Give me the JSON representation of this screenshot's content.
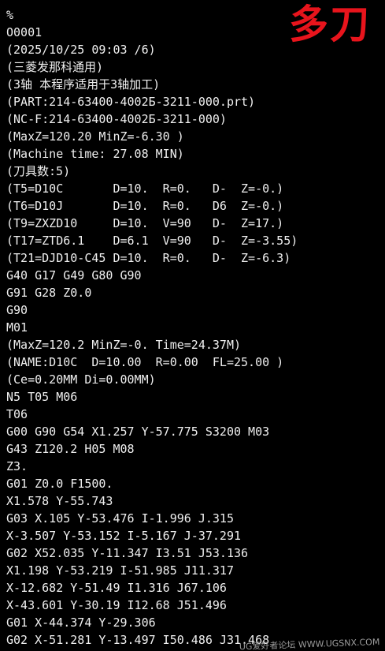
{
  "stamp_text": "多刀",
  "stamp_color": "#e8141c",
  "lines": [
    "%",
    "O0001",
    "(2025/10/25 09:03 /6)",
    "(三菱发那科通用)",
    "(3轴 本程序适用于3轴加工)",
    "(PART:214-63400-4002Б-3211-000.prt)",
    "(NC-F:214-63400-4002Б-3211-000)",
    "(MaxZ=120.20 MinZ=-6.30 )",
    "(Machine time: 27.08 MIN)",
    "(刀具数:5)",
    "(T5=D10C       D=10.  R=0.   D-  Z=-0.)",
    "(T6=D10J       D=10.  R=0.   D6  Z=-0.)",
    "(T9=ZXZD10     D=10.  V=90   D-  Z=17.)",
    "(T17=ZTD6.1    D=6.1  V=90   D-  Z=-3.55)",
    "(T21=DJD10-C45 D=10.  R=0.   D-  Z=-6.3)",
    "G40 G17 G49 G80 G90",
    "G91 G28 Z0.0",
    "G90",
    "M01",
    "(MaxZ=120.2 MinZ=-0. Time=24.37M)",
    "(NAME:D10C  D=10.00  R=0.00  FL=25.00 )",
    "(Ce=0.20MM Di=0.00MM)",
    "N5 T05 M06",
    "T06",
    "G00 G90 G54 X1.257 Y-57.775 S3200 M03",
    "G43 Z120.2 H05 M08",
    "Z3.",
    "G01 Z0.0 F1500.",
    "X1.578 Y-55.743",
    "G03 X.105 Y-53.476 I-1.996 J.315",
    "X-3.507 Y-53.152 I-5.167 J-37.291",
    "G02 X52.035 Y-11.347 I3.51 J53.136",
    "X1.198 Y-53.219 I-51.985 J11.317",
    "X-12.682 Y-51.49 I1.316 J67.106",
    "X-43.601 Y-30.19 I12.68 J51.496",
    "G01 X-44.374 Y-29.306",
    "G02 X-51.281 Y-13.497 I50.486 J31.468"
  ],
  "watermark": "UG爱好者论坛 WWW.UGSNX.COM"
}
